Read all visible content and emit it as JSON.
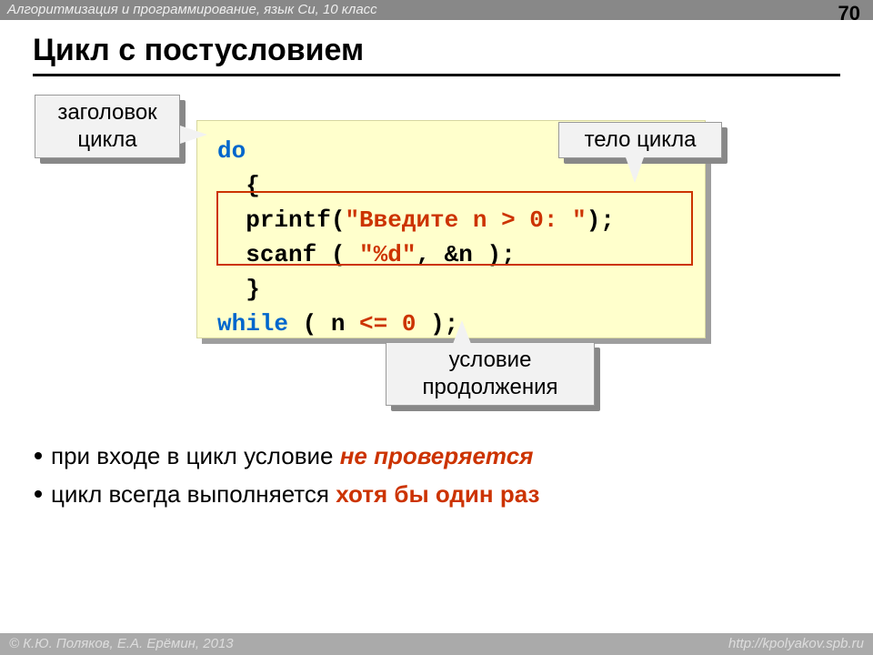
{
  "header": {
    "course": "Алгоритмизация и программирование, язык Си, 10 класс",
    "page_number": "70"
  },
  "title": "Цикл с постусловием",
  "callouts": {
    "header_label": "заголовок цикла",
    "body_label": "тело цикла",
    "condition_label": "условие продолжения"
  },
  "code": {
    "do_kw": "do",
    "brace_open": "{",
    "line_printf_a": "printf(",
    "line_printf_str": "\"Введите n > 0: \"",
    "line_printf_b": ");",
    "line_scanf_a": "scanf ( ",
    "line_scanf_str": "\"%d\"",
    "line_scanf_b": ", &n );",
    "brace_close": "}",
    "while_kw": "while",
    "while_cond_a": " ( n ",
    "while_op": "<=",
    "while_cond_b": " ",
    "while_zero": "0",
    "while_cond_c": " );"
  },
  "bullets": {
    "b1_a": "при входе в цикл условие ",
    "b1_em": "не проверяется",
    "b2_a": "цикл всегда выполняется ",
    "b2_em": "хотя бы один раз"
  },
  "footer": {
    "left": "© К.Ю. Поляков, Е.А. Ерёмин, 2013",
    "right": "http://kpolyakov.spb.ru"
  }
}
